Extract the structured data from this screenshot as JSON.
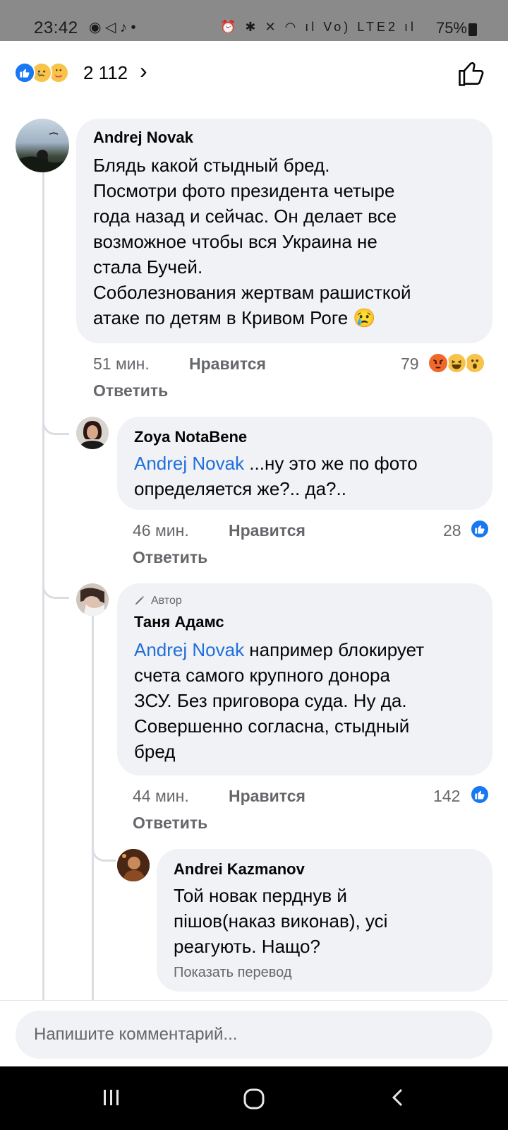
{
  "status_bar": {
    "time": "23:42",
    "left_icons": "◉ ◁ ♪ •",
    "right_icons": "⏰ ✱ ✕ ◠ ıl Vo) LTE2 ıl",
    "battery": "75%"
  },
  "reactions": {
    "count": "2 112",
    "chevron": "›"
  },
  "comments": [
    {
      "author": "Andrej Novak",
      "lines": [
        "Блядь какой стыдный бред.",
        "Посмотри фото президента четыре",
        "года назад и сейчас. Он делает все",
        "возможное чтобы вся Украина не",
        "стала Бучей.",
        "Соболезнования жертвам рашисткой",
        "атаке по детям в Кривом Роге 😢"
      ],
      "time": "51 мин.",
      "like_label": "Нравится",
      "reply_label": "Ответить",
      "reaction_count": "79"
    },
    {
      "author": "Zoya NotaBene",
      "mention": "Andrej Novak",
      "lines": [
        " ...ну это же по фото",
        "определяется же?.. да?.."
      ],
      "time": "46 мин.",
      "like_label": "Нравится",
      "reply_label": "Ответить",
      "reaction_count": "28"
    },
    {
      "author_tag": "Автор",
      "author": "Таня Адамс",
      "mention": "Andrej Novak",
      "lines": [
        " например блокирует",
        "счета самого крупного донора",
        "ЗСУ. Без приговора суда. Ну да.",
        "Совершенно согласна, стыдный",
        "бред"
      ],
      "time": "44 мин.",
      "like_label": "Нравится",
      "reply_label": "Ответить",
      "reaction_count": "142"
    },
    {
      "author": "Andrei Kazmanov",
      "lines": [
        "Той новак перднув й",
        "пішов(наказ виконав), усі",
        "реагують. Нащо?"
      ],
      "translate_label": "Показать перевод"
    }
  ],
  "composer": {
    "placeholder": "Напишите комментарий..."
  },
  "colors": {
    "bubble": "#f0f2f5",
    "mention": "#216fdb",
    "like_blue": "#1877f2",
    "meta_gray": "#65676b"
  },
  "icons": [
    "like-reaction-icon",
    "sad-reaction-icon",
    "care-reaction-icon",
    "like-outline-icon",
    "angry-reaction-icon",
    "haha-reaction-icon",
    "wow-reaction-icon",
    "pencil-icon",
    "recent-apps-icon",
    "home-icon",
    "back-icon"
  ]
}
